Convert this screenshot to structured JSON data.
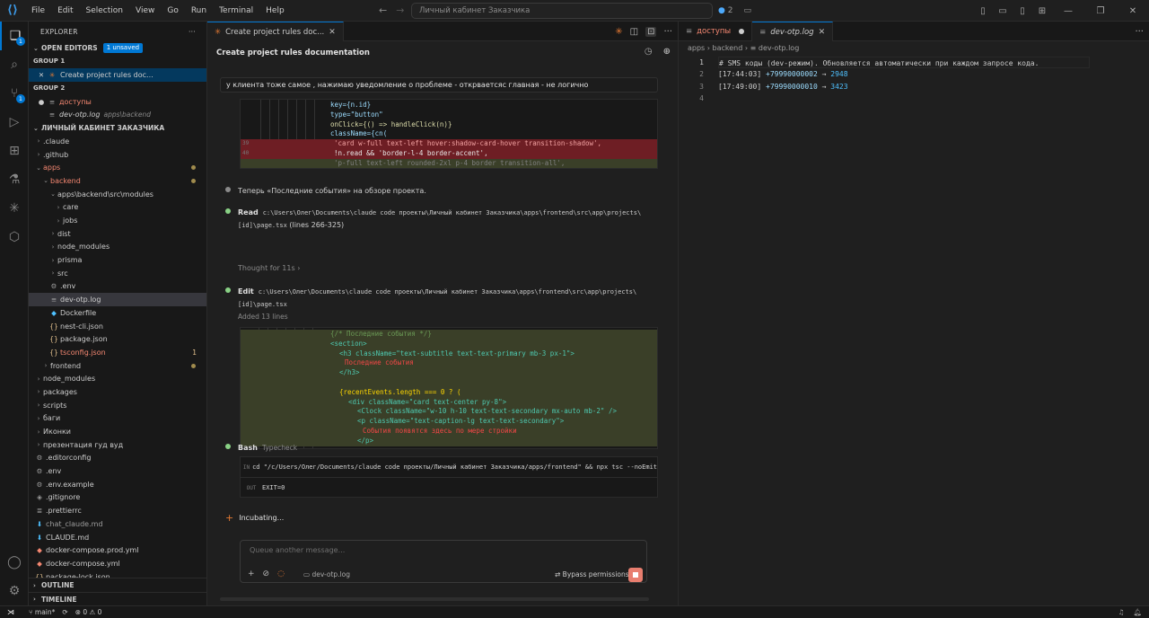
{
  "menu": [
    "File",
    "Edit",
    "Selection",
    "View",
    "Go",
    "Run",
    "Terminal",
    "Help"
  ],
  "search": {
    "placeholder": "Личный кабинет Заказчика"
  },
  "title_counter": "2",
  "explorer": {
    "title": "EXPLORER",
    "open_editors_label": "OPEN EDITORS",
    "unsaved_badge": "1 unsaved",
    "group1_label": "GROUP 1",
    "group1_items": [
      {
        "name": "Create project rules doc..."
      }
    ],
    "group2_label": "GROUP 2",
    "group2_items": [
      {
        "name": "доступы"
      },
      {
        "name": "dev-otp.log",
        "desc": "apps\\backend"
      }
    ],
    "workspace_label": "ЛИЧНЫЙ КАБИНЕТ ЗАКАЗЧИКА",
    "tree": [
      ".claude",
      ".github",
      "apps",
      "backend",
      "apps\\backend\\src\\modules",
      "care",
      "jobs",
      "dist",
      "node_modules",
      "prisma",
      "src",
      ".env",
      "dev-otp.log",
      "Dockerfile",
      "nest-cli.json",
      "package.json",
      "tsconfig.json",
      "frontend",
      "node_modules",
      "packages",
      "scripts",
      "баги",
      "Иконки",
      "презентация гуд вуд",
      ".editorconfig",
      ".env",
      ".env.example",
      ".gitignore",
      ".prettierrc",
      "chat_claude.md",
      "CLAUDE.md",
      "docker-compose.prod.yml",
      "docker-compose.yml",
      "package-lock.json"
    ],
    "tsconfig_problems": "1",
    "outline_label": "OUTLINE",
    "timeline_label": "TIMELINE"
  },
  "chat": {
    "tab_label": "Create project rules doc...",
    "title": "Create project rules documentation",
    "user_message": "у клиента тоже самое , нажимаю уведомление о проблеме - открваетсяс главная - не логично",
    "code1": {
      "lines": [
        "key={n.id}",
        "type=\"button\"",
        "onClick={() => handleClick(n)}",
        "className={cn(",
        "'card w-full text-left hover:shadow-card-hover transition-shadow',",
        "!n.read && 'border-l-4 border-accent',",
        "'p-full text-left rounded-2xl p-4 border transition-all',"
      ],
      "line_numbers": [
        "39",
        "40"
      ]
    },
    "msg1": "Теперь «Последние события» на обзоре проекта.",
    "read_tool": "Read",
    "read_path": "c:\\Users\\Олег\\Documents\\claude code проекты\\Личный кабинет Заказчика\\apps\\frontend\\src\\app\\projects\\[id]\\page.tsx",
    "read_lines": "(lines 266-325)",
    "thought": "Thought for 11s",
    "edit_tool": "Edit",
    "edit_path": "c:\\Users\\Олег\\Documents\\claude code проекты\\Личный кабинет Заказчика\\apps\\frontend\\src\\app\\projects\\[id]\\page.tsx",
    "edit_added": "Added 13 lines",
    "code2": {
      "lines": [
        "{/* Последние события */}",
        "<section>",
        "<h3 className=\"text-subtitle text-text-primary mb-3 px-1\">",
        "Последние события",
        "</h3>",
        "",
        "{recentEvents.length === 0 ? (",
        "<div className=\"card text-center py-8\">",
        "<Clock className=\"w-10 h-10 text-text-secondary mx-auto mb-2\" />",
        "<p className=\"text-caption-lg text-text-secondary\">",
        "События появятся здесь по мере стройки",
        "</p>"
      ]
    },
    "bash_tool": "Bash",
    "bash_desc": "Typecheck",
    "bash_in_label": "IN",
    "bash_command": "cd \"/c/Users/Олег/Documents/claude code проекты/Личный кабинет Заказчика/apps/frontend\" && npx tsc --noEmit",
    "bash_out_label": "OUT",
    "bash_output": "EXIT=0",
    "status": "Incubating...",
    "composer_placeholder": "Queue another message...",
    "composer_file": "dev-otp.log",
    "bypass": "Bypass permissions"
  },
  "editor": {
    "tabs": [
      {
        "label": "доступы"
      },
      {
        "label": "dev-otp.log"
      }
    ],
    "breadcrumbs": [
      "apps",
      "backend",
      "dev-otp.log"
    ],
    "lines": [
      {
        "n": "1",
        "text": "# SMS коды (dev-режим). Обновляется автоматически при каждом запросе кода."
      },
      {
        "n": "2",
        "time": "[17:44:03]",
        "phone": "+79990000002",
        "code": "2948"
      },
      {
        "n": "3",
        "time": "[17:49:00]",
        "phone": "+79990000010",
        "code": "3423"
      },
      {
        "n": "4",
        "text": ""
      }
    ]
  },
  "statusbar": {
    "branch": "main*",
    "problems": "0",
    "warnings": "0"
  }
}
